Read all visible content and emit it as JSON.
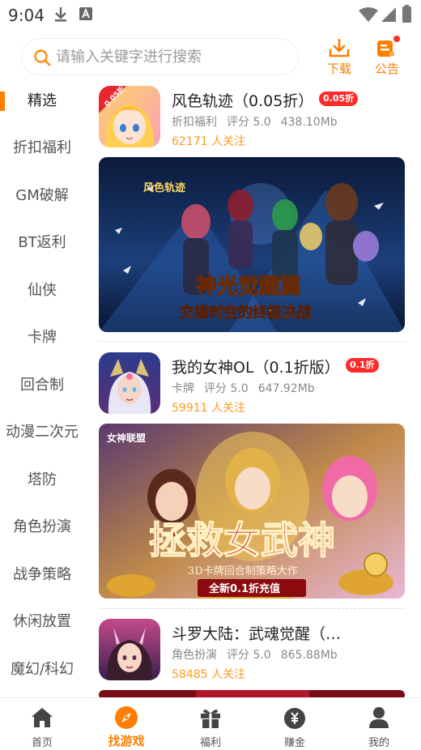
{
  "status_bar": {
    "time": "9:04",
    "left_icons": [
      "download-notification-icon",
      "font-app-notification-icon"
    ],
    "right_icons": [
      "wifi-icon",
      "cellular-signal-icon",
      "battery-icon"
    ]
  },
  "header": {
    "search_placeholder": "请输入关键字进行搜索",
    "download_label": "下载",
    "notice_label": "公告",
    "accent_color": "#ff7d00"
  },
  "sidebar": {
    "items": [
      {
        "label": "精选",
        "active": true
      },
      {
        "label": "折扣福利"
      },
      {
        "label": "GM破解"
      },
      {
        "label": "BT返利"
      },
      {
        "label": "仙侠"
      },
      {
        "label": "卡牌"
      },
      {
        "label": "回合制"
      },
      {
        "label": "动漫二次元"
      },
      {
        "label": "塔防"
      },
      {
        "label": "角色扮演"
      },
      {
        "label": "战争策略"
      },
      {
        "label": "休闲放置"
      },
      {
        "label": "魔幻/科幻"
      }
    ]
  },
  "games": [
    {
      "title": "风色轨迹（0.05折）",
      "tag": "0.05折",
      "icon_corner_tag": "0.05折",
      "category": "折扣福利",
      "rating": "评分 5.0",
      "size": "438.10Mb",
      "followers": "62171 人关注",
      "banner_logo": "风色轨迹",
      "banner_headline": "神光觉醒篇",
      "banner_subline": "交错时空的终极决战"
    },
    {
      "title": "我的女神OL（0.1折版）",
      "tag": "0.1折",
      "category": "卡牌",
      "rating": "评分 5.0",
      "size": "647.92Mb",
      "followers": "59911 人关注",
      "banner_logo": "女神联盟",
      "banner_headline": "拯救女武神",
      "banner_subline": "3D卡牌回合制策略大作",
      "banner_ribbon": "全新0.1折充值"
    },
    {
      "title": "斗罗大陆：武魂觉醒（…",
      "category": "角色扮演",
      "rating": "评分 5.0",
      "size": "865.88Mb",
      "followers": "58485 人关注"
    }
  ],
  "tabbar": {
    "tabs": [
      {
        "label": "首页",
        "icon": "home-icon"
      },
      {
        "label": "找游戏",
        "icon": "compass-icon",
        "active": true
      },
      {
        "label": "福利",
        "icon": "gift-icon"
      },
      {
        "label": "赚金",
        "icon": "money-bag-icon"
      },
      {
        "label": "我的",
        "icon": "user-icon"
      }
    ]
  }
}
